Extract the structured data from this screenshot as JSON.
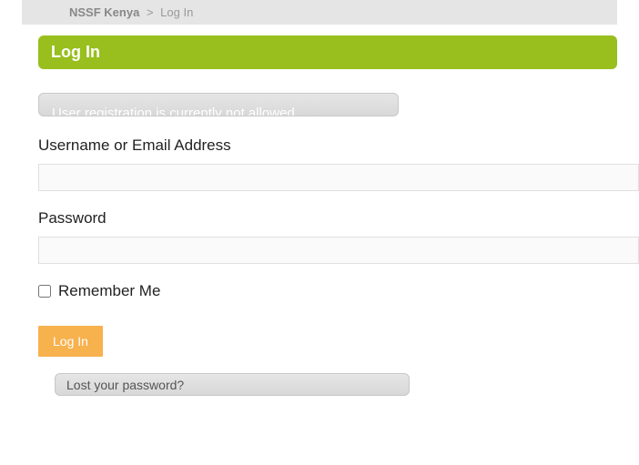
{
  "breadcrumb": {
    "site": "NSSF Kenya",
    "separator": ">",
    "current": "Log In"
  },
  "page_title": "Log In",
  "notice": "User registration is currently not allowed.",
  "form": {
    "username_label": "Username or Email Address",
    "password_label": "Password",
    "remember_label": "Remember Me",
    "submit_label": "Log In",
    "lost_password_label": "Lost your password?"
  },
  "colors": {
    "accent_green": "#98bf1d",
    "accent_orange": "#f7b14d"
  }
}
